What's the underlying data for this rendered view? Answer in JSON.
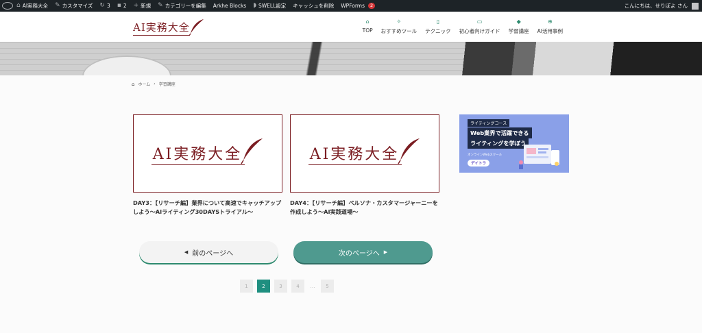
{
  "adminbar": {
    "site_name": "AI実務大全",
    "customize": "カスタマイズ",
    "updates_count": "3",
    "comments_count": "2",
    "new": "新規",
    "edit_category": "カテゴリーを編集",
    "arkhe": "Arkhe Blocks",
    "swell": "SWELL設定",
    "cache": "キャッシュを削除",
    "wpforms": "WPForms",
    "wpforms_badge": "2",
    "greeting": "こんにちは、せりぽよ さん"
  },
  "header": {
    "logo_text": "AI実務大全",
    "nav": [
      {
        "label": "TOP",
        "icon": "home-icon"
      },
      {
        "label": "おすすめツール",
        "icon": "wrench-icon"
      },
      {
        "label": "テクニック",
        "icon": "book-icon"
      },
      {
        "label": "初心者向けガイド",
        "icon": "id-card-icon"
      },
      {
        "label": "学習講座",
        "icon": "graduation-cap-icon"
      },
      {
        "label": "AI活用事例",
        "icon": "magnifier-icon"
      }
    ]
  },
  "breadcrumb": {
    "home": "ホーム",
    "current": "学習講座"
  },
  "cards": [
    {
      "logo_text": "AI実務大全",
      "title": "DAY3：【リサーチ編】業界について高速でキャッチアップしよう〜AIライティング30DAYSトライアル〜"
    },
    {
      "logo_text": "AI実務大全",
      "title": "DAY4：【リサーチ編】ペルソナ・カスタマージャーニーを作成しよう〜AI実践道場〜"
    }
  ],
  "ad": {
    "tag": "ライティングコース",
    "line1": "Web業界で活躍できる",
    "line2": "ライティングを学ぼう",
    "sub": "オンラインWebスクール",
    "brand": "デイトラ"
  },
  "pager": {
    "prev": "前のページへ",
    "next": "次のページへ"
  },
  "pagination": {
    "pages": [
      "1",
      "2",
      "3",
      "4",
      "5"
    ],
    "current": "2",
    "ellipsis": "…"
  },
  "colors": {
    "brand": "#7b1d22",
    "accent": "#1f8f80",
    "adminbar": "#1d2327"
  }
}
